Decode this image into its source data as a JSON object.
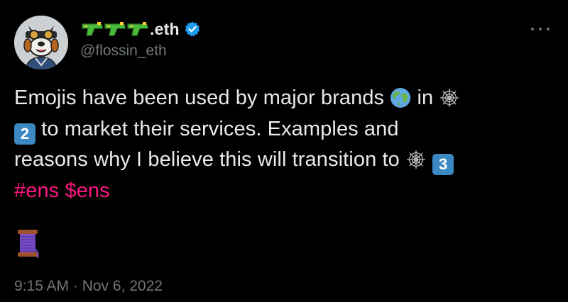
{
  "author": {
    "display_name_suffix": ".eth",
    "display_name_emojis": [
      "water-pistol-icon",
      "water-pistol-icon",
      "water-pistol-icon"
    ],
    "handle": "@flossin_eth",
    "verified": true
  },
  "tweet": {
    "line1": "Emojis have been used by major brands",
    "line1_after_globe": "in",
    "line2": "to market their services. Examples and",
    "line3": "reasons why I believe this will transition to",
    "keycap_2": "2",
    "keycap_3": "3",
    "hashtag": "#ens",
    "cashtag": "$ens",
    "emojis": [
      "globe-icon",
      "spider-web-icon",
      "keycap-2-icon",
      "spider-web-icon",
      "keycap-3-icon",
      "thread-spool-icon"
    ]
  },
  "timestamp": "9:15 AM · Nov 6, 2022",
  "colors": {
    "background": "#000000",
    "text": "#e7e9ea",
    "muted": "#71767b",
    "hashtag": "#f91880",
    "verified": "#1d9bf0",
    "keycap": "#3b88c3"
  }
}
